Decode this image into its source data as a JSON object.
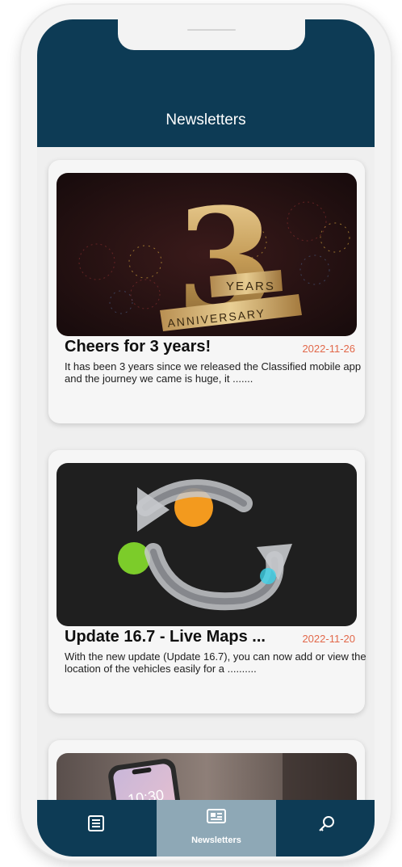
{
  "app": {
    "title": "Newsletters"
  },
  "newsletters": [
    {
      "title": "Cheers for 3 years!",
      "date": "2022-11-26",
      "description": "It has been 3 years since we released the Classified mobile app and the journey we came is huge, it .......",
      "image": {
        "big_number": "3",
        "ribbon_top": "YEARS",
        "ribbon_bottom": "ANNIVERSARY"
      }
    },
    {
      "title": "Update 16.7 - Live Maps ...",
      "date": "2022-11-20",
      "description": "With the new update (Update 16.7), you can now add or view the location of the vehicles easily for a ..........",
      "image": {
        "icon": "refresh-arrows-icon"
      }
    },
    {
      "image": {
        "phone_time": "10:30"
      }
    }
  ],
  "bottom_nav": {
    "items": [
      {
        "icon": "list-icon",
        "label": ""
      },
      {
        "icon": "newspaper-icon",
        "label": "Newsletters",
        "active": true
      },
      {
        "icon": "key-icon",
        "label": ""
      }
    ]
  },
  "colors": {
    "primary": "#0d3b55",
    "accent_date": "#e2684a",
    "active_tab": "#8ea8b6",
    "background": "#efefef"
  }
}
